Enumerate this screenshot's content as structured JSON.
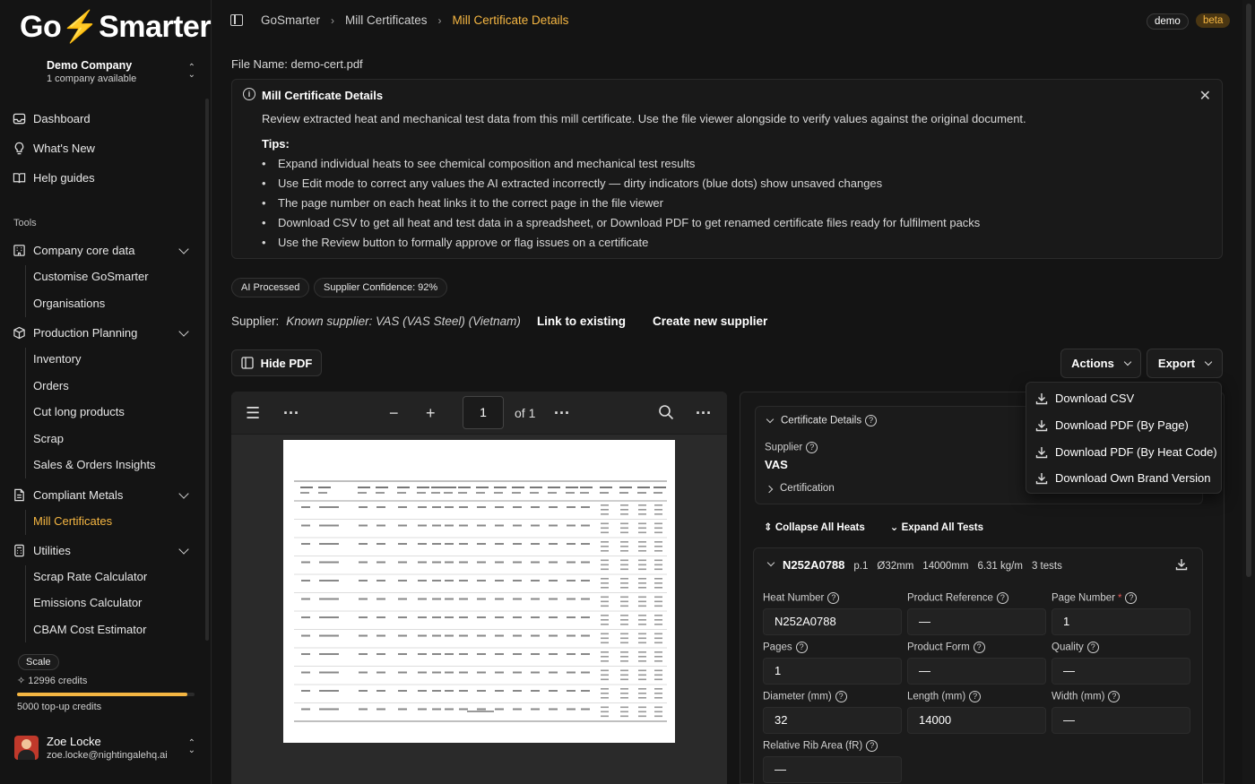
{
  "sidebar": {
    "logo": {
      "pre": "Go",
      "bolt": "⚡",
      "post": "Smarter"
    },
    "company": {
      "name": "Demo Company",
      "sub": "1 company available"
    },
    "top_items": [
      {
        "label": "Dashboard",
        "icon": "inbox-icon"
      },
      {
        "label": "What's New",
        "icon": "lightbulb-icon"
      },
      {
        "label": "Help guides",
        "icon": "book-icon"
      }
    ],
    "section_label": "Tools",
    "groups": [
      {
        "label": "Company core data",
        "items": [
          "Customise GoSmarter",
          "Organisations"
        ]
      },
      {
        "label": "Production Planning",
        "items": [
          "Inventory",
          "Orders",
          "Cut long products",
          "Scrap",
          "Sales & Orders Insights"
        ]
      },
      {
        "label": "Compliant Metals",
        "items": [
          "Mill Certificates"
        ]
      },
      {
        "label": "Utilities",
        "items": [
          "Scrap Rate Calculator",
          "Emissions Calculator",
          "CBAM Cost Estimator"
        ]
      }
    ],
    "plan": "Scale",
    "credits": "12996 credits",
    "credits_fraction": 0.96,
    "topup": "5000 top-up credits",
    "user": {
      "name": "Zoe Locke",
      "email": "zoe.locke@nightingalehq.ai"
    }
  },
  "header": {
    "breadcrumbs": [
      "GoSmarter",
      "Mill Certificates",
      "Mill Certificate Details"
    ],
    "env_badge": "demo",
    "beta_badge": "beta"
  },
  "file_name": "File Name: demo-cert.pdf",
  "info": {
    "title": "Mill Certificate Details",
    "description": "Review extracted heat and mechanical test data from this mill certificate. Use the file viewer alongside to verify values against the original document.",
    "tips_label": "Tips:",
    "tips": [
      "Expand individual heats to see chemical composition and mechanical test results",
      "Use Edit mode to correct any values the AI extracted incorrectly — dirty indicators (blue dots) show unsaved changes",
      "The page number on each heat links it to the correct page in the file viewer",
      "Download CSV to get all heat and test data in a spreadsheet, or Download PDF to get renamed certificate files ready for fulfilment packs",
      "Use the Review button to formally approve or flag issues on a certificate"
    ]
  },
  "badges": [
    "AI Processed",
    "Supplier Confidence: 92%"
  ],
  "supplier": {
    "label": "Supplier:",
    "known": "Known supplier: VAS (VAS Steel) (Vietnam)",
    "link_existing": "Link to existing",
    "create_new": "Create new supplier"
  },
  "toolbar": {
    "hide_pdf": "Hide PDF",
    "actions": "Actions",
    "export": "Export"
  },
  "export_menu": [
    "Download CSV",
    "Download PDF (By Page)",
    "Download PDF (By Heat Code)",
    "Download Own Brand Version"
  ],
  "pdf_viewer": {
    "page": "1",
    "of": "of 1"
  },
  "cert_details": {
    "header": "Certificate Details",
    "supplier_label": "Supplier",
    "supplier_value": "VAS",
    "certification_label": "Certification",
    "collapse_all": "Collapse All Heats",
    "expand_all": "Expand All Tests"
  },
  "heat": {
    "code": "N252A0788",
    "page": "p.1",
    "diameter": "Ø32mm",
    "length": "14000mm",
    "weight": "6.31 kg/m",
    "tests": "3 tests",
    "fields": [
      {
        "label": "Heat Number",
        "value": "N252A0788"
      },
      {
        "label": "Product Reference",
        "value": "—"
      },
      {
        "label": "Page Number",
        "value": "1",
        "required": "*"
      },
      {
        "label": "Pages",
        "value": "1"
      },
      {
        "label": "Product Form",
        "value": "—"
      },
      {
        "label": "Quality",
        "value": "—"
      },
      {
        "label": "Diameter (mm)",
        "value": "32"
      },
      {
        "label": "Length (mm)",
        "value": "14000"
      },
      {
        "label": "Width (mm)",
        "value": "—"
      },
      {
        "label": "Relative Rib Area (fR)",
        "value": "—"
      }
    ]
  }
}
